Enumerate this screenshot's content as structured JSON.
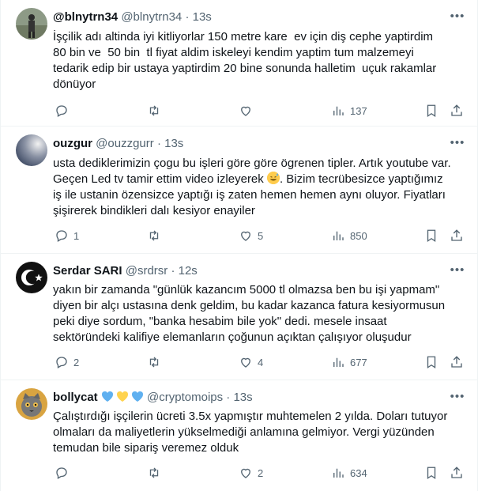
{
  "tweets": [
    {
      "name": "@blnytrn34",
      "handle": "@blnytrn34",
      "time": "13s",
      "text": "İşçilik adı altinda iyi kitliyorlar 150 metre kare  ev için diş cephe yaptirdim\n80 bin ve  50 bin  tl fiyat aldim iskeleyi kendim yaptim tum malzemeyi\ntedarik edip bir ustaya yaptirdim 20 bine sonunda halletim  uçuk rakamlar\ndönüyor",
      "replies": "",
      "retweets": "",
      "likes": "",
      "views": "137"
    },
    {
      "name": "ouzgur",
      "handle": "@ouzzgurr",
      "time": "13s",
      "text_before_emoji": "usta dediklerimizin çogu bu işleri göre göre ögrenen tipler. Artık youtube var.\nGeçen Led tv tamir ettim video izleyerek ",
      "text_after_emoji": ". Bizim tecrübesizce yaptığımız\niş ile ustanin özensizce yaptığı iş zaten hemen hemen aynı oluyor. Fiyatları\nşişirerek bindikleri dalı kesiyor enayiler",
      "replies": "1",
      "retweets": "",
      "likes": "5",
      "views": "850"
    },
    {
      "name": "Serdar SARI",
      "handle": "@srdrsr",
      "time": "12s",
      "text": "yakın bir zamanda \"günlük kazancım 5000 tl olmazsa ben bu işi yapmam\"\ndiyen bir alçı ustasına denk geldim, bu kadar kazanca fatura kesiyormusun\npeki diye sordum, \"banka hesabim bile yok\" dedi. mesele insaat\nsektöründeki kalifiye elemanların çoğunun açıktan çalışıyor oluşudur",
      "replies": "2",
      "retweets": "",
      "likes": "4",
      "views": "677"
    },
    {
      "name": "bollycat",
      "handle": "@cryptomoips",
      "time": "13s",
      "text": "Çalıştırdığı işçilerin ücreti 3.5x yapmıştır muhtemelen 2 yılda. Doları tutuyor\nolmaları da maliyetlerin yükselmediği anlamına gelmiyor. Vergi yüzünden\ntemudan bile sipariş veremez olduk",
      "replies": "",
      "retweets": "",
      "likes": "2",
      "views": "634"
    }
  ],
  "separator": "·",
  "colors": {
    "text": "#0f1419",
    "secondary": "#536471",
    "border": "#eff3f4",
    "heart_blue": "#5fb0f0",
    "heart_yellow": "#ffd34f"
  },
  "icons": [
    "more-icon",
    "reply-icon",
    "retweet-icon",
    "like-icon",
    "views-icon",
    "bookmark-icon",
    "share-icon",
    "sweat-smile-emoji"
  ]
}
